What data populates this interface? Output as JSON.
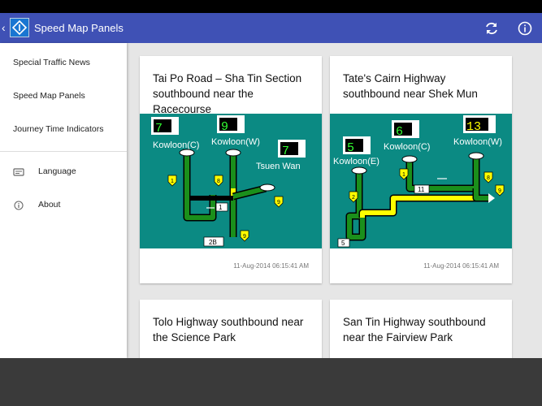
{
  "app": {
    "title": "Speed Map Panels"
  },
  "drawer": {
    "items": [
      {
        "label": "Special Traffic News"
      },
      {
        "label": "Speed Map Panels"
      },
      {
        "label": "Journey Time Indicators"
      },
      {
        "label": "Language",
        "icon": "language-icon"
      },
      {
        "label": "About",
        "icon": "info-icon"
      }
    ]
  },
  "cards": [
    {
      "title": "Tai Po Road – Sha Tin Section southbound near the Racecourse",
      "timestamp": "11-Aug-2014 06:15:41 AM",
      "map": {
        "speeds": [
          "7",
          "9",
          "7"
        ],
        "places": [
          "Kowloon(C)",
          "Kowloon(W)",
          "Tsuen Wan"
        ],
        "route_numbers": [
          "1",
          "8",
          "9",
          "9"
        ],
        "exits": [
          "1",
          "2B"
        ]
      }
    },
    {
      "title": "Tate's Cairn Highway southbound near Shek Mun",
      "timestamp": "11-Aug-2014 06:15:41 AM",
      "map": {
        "speeds": [
          "5",
          "6",
          "13"
        ],
        "places": [
          "Kowloon(E)",
          "Kowloon(C)",
          "Kowloon(W)"
        ],
        "route_numbers": [
          "2",
          "1",
          "8",
          "9"
        ],
        "exits": [
          "11",
          "5"
        ]
      }
    },
    {
      "title": "Tolo Highway southbound near the Science Park"
    },
    {
      "title": "San Tin Highway southbound near the Fairview Park"
    }
  ]
}
